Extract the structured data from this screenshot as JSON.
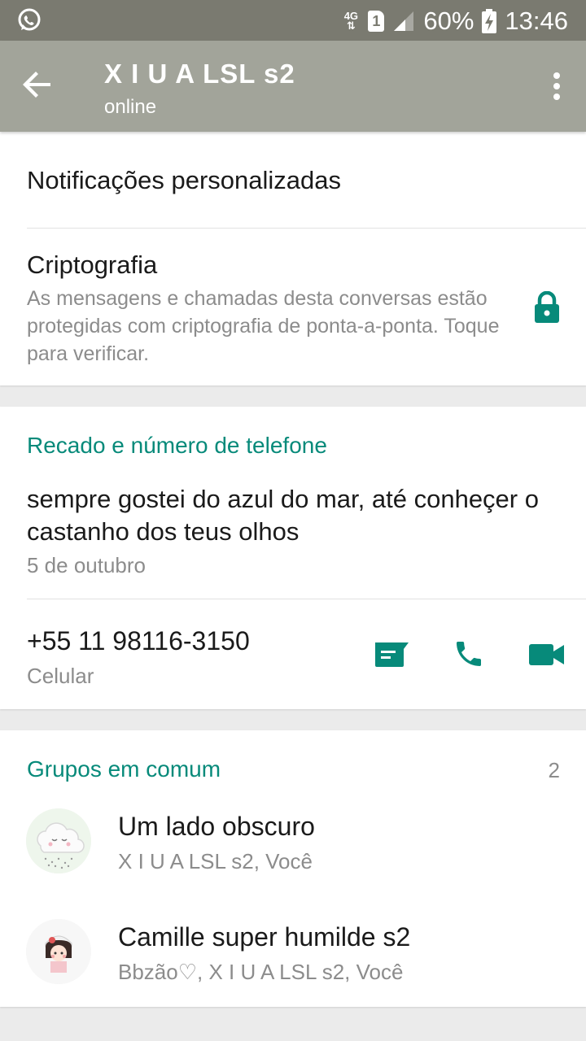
{
  "status_bar": {
    "network": "4G",
    "sim": "1",
    "battery": "60%",
    "time": "13:46"
  },
  "app_bar": {
    "title": "X I U A LSL s2",
    "subtitle": "online"
  },
  "settings": {
    "custom_notifications": "Notificações personalizadas",
    "encryption_title": "Criptografia",
    "encryption_desc": "As mensagens e chamadas desta conversas estão protegidas com criptografia de ponta-a-ponta. Toque para verificar."
  },
  "about": {
    "section_title": "Recado e número de telefone",
    "status": "sempre gostei do azul do mar, até conheçer o castanho dos teus olhos",
    "status_date": "5 de outubro",
    "phone": "+55 11 98116-3150",
    "phone_type": "Celular"
  },
  "groups": {
    "section_title": "Grupos em comum",
    "count": "2",
    "items": [
      {
        "name": "Um lado obscuro",
        "members": "X I U A LSL s2, Você"
      },
      {
        "name": "Camille super humilde s2",
        "members": "Bbzão♡, X I U A LSL s2, Você"
      }
    ]
  },
  "colors": {
    "accent": "#078a7a",
    "app_bar": "#a2a49a",
    "status_bar": "#7a7a70"
  }
}
